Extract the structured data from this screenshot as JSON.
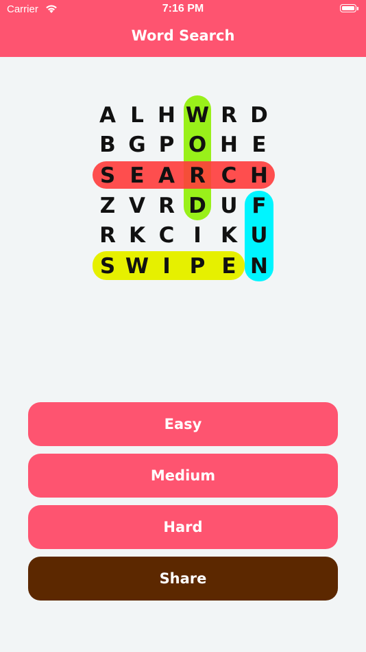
{
  "status_bar": {
    "carrier": "Carrier",
    "time": "7:16 PM"
  },
  "header": {
    "title": "Word Search"
  },
  "puzzle": {
    "rows": [
      [
        "A",
        "L",
        "H",
        "W",
        "R",
        "D"
      ],
      [
        "B",
        "G",
        "P",
        "O",
        "H",
        "E"
      ],
      [
        "S",
        "E",
        "A",
        "R",
        "C",
        "H"
      ],
      [
        "Z",
        "V",
        "R",
        "D",
        "U",
        "F"
      ],
      [
        "R",
        "K",
        "C",
        "I",
        "K",
        "U"
      ],
      [
        "S",
        "W",
        "I",
        "P",
        "E",
        "N"
      ]
    ],
    "highlight_colors": {
      "word": "#99f01a",
      "search": "#ff4a4a",
      "fun": "#00f5ff",
      "swipe": "#e6f000"
    }
  },
  "buttons": {
    "easy": "Easy",
    "medium": "Medium",
    "hard": "Hard",
    "share": "Share"
  },
  "colors": {
    "accent": "#fe5470",
    "share": "#5c2800",
    "background": "#f2f5f6"
  }
}
